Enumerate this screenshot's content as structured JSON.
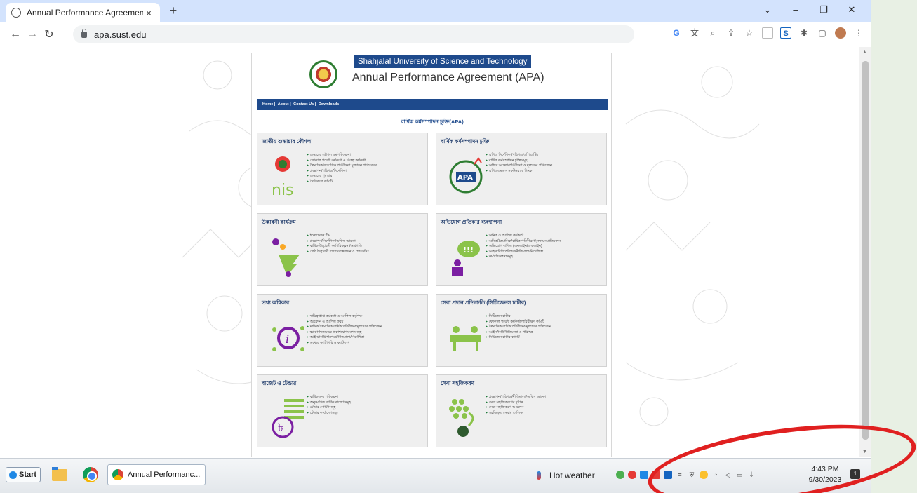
{
  "browser": {
    "tab_title": "Annual Performance Agreement",
    "tab_close": "×",
    "new_tab": "+",
    "window_controls": [
      "⌄",
      "–",
      "❐",
      "✕"
    ],
    "url": "apa.sust.edu",
    "toolbar_icons": [
      "google-icon",
      "translate-icon",
      "zoom-icon",
      "share-icon",
      "bookmark-star-icon",
      "extension-icon",
      "s-extension-icon",
      "puzzle-icon",
      "sidepanel-icon",
      "profile-avatar-icon",
      "menu-icon"
    ]
  },
  "site": {
    "university": "Shahjalal University of Science and Technology",
    "title": "Annual Performance Agreement (APA)",
    "menu": [
      "Home |",
      "About |",
      "Contact Us |",
      "Downloads"
    ],
    "subtitle": "বার্ষিক কর্মসম্পাদন চুক্তি(APA)",
    "cards": [
      {
        "title": "জাতীয় শুদ্ধাচার কৌশল",
        "icon": "nis-icon",
        "items": [
          "শুদ্ধাচার কৌশল কর্মপরিকল্পনা",
          "ফোকাল পয়েন্ট কর্মকর্তা ও বিকল্প কর্মকর্তা",
          "ত্রৈমাসিক/ষাণ্মাসিক পরিবীক্ষণ মূল্যায়ন প্রতিবেদন",
          "প্রজ্ঞাপন/পরিপত্র/নির্দেশিকা",
          "শুদ্ধাচার পুরস্কার",
          "নৈতিকতা কমিটি"
        ]
      },
      {
        "title": "বার্ষিক কর্মসম্পাদন চুক্তি",
        "icon": "apa-icon",
        "items": [
          "এপিএ নির্দেশিকা/পরিপত্র/এপিএ টিম",
          "বার্ষিক কর্মসম্পাদন চুক্তিসমূহ",
          "অফিস আদেশ/পরিবীক্ষণ ও মূল্যায়ন প্রতিবেদন",
          "এপিএএমএস সফটওয়্যার লিংক"
        ]
      },
      {
        "title": "উদ্ভাবনী কার্যক্রম",
        "icon": "innovation-icon",
        "items": [
          "ইনোভেশন টিম",
          "প্রজ্ঞাপন/নির্দেশিকা/অফিস আদেশ",
          "বার্ষিক উদ্ভাবনী কর্মপরিকল্পনা/অগ্রগতি",
          "শ্রেষ্ঠ উদ্ভাবনী ধারণা/বাস্তবায়ন ও শোকেসিং"
        ]
      },
      {
        "title": "অভিযোগ প্রতিকার ব্যবস্থাপনা",
        "icon": "grievance-icon",
        "items": [
          "অনিক ও আপিল কর্মকর্তা",
          "অনিক/ত্রৈমাসিক/বার্ষিক পরিবীক্ষণ/মূল্যায়ন প্রতিবেদন",
          "অভিযোগ দাখিল (অনলাইন/অফলাইন)",
          "আইন/বিধি/পরিপত্র/নীতিমালা/নির্দেশিকা",
          "কর্মপরিকল্পনাসমূহ"
        ]
      },
      {
        "title": "তথ্য অধিকার",
        "icon": "information-icon",
        "items": [
          "দায়িত্বপ্রাপ্ত কর্মকর্তা ও আপিল কর্তৃপক্ষ",
          "আবেদন ও আপিল ফরম",
          "মাসিক/ত্রৈমাসিক/বার্ষিক পরিবীক্ষণ/মূল্যায়ন প্রতিবেদন",
          "স্বপ্রণোদিতভাবে প্রকাশযোগ্য তথ্যসমূহ",
          "আইন/বিধি/পরিপত্র/নীতিমালা/নির্দেশিকা",
          "তথ্যের ক্যাটাগরি ও ক্যাটালগ"
        ]
      },
      {
        "title": "সেবা প্রদান প্রতিশ্রুতি (সিটিজেনস চার্টার)",
        "icon": "citizen-charter-icon",
        "items": [
          "সিটিজেন চার্টার",
          "ফোকাল পয়েন্ট কর্মকর্তা/পরিবীক্ষণ কমিটি",
          "ত্রৈমাসিক/বার্ষিক পরিবীক্ষণ/মূল্যায়ন প্রতিবেদন",
          "আইন/বিধি/নীতিমালা ও পরিপত্র",
          "সিটিজেন চার্টার কমিটি"
        ]
      },
      {
        "title": "বাজেট ও টেন্ডার",
        "icon": "budget-icon",
        "items": [
          "বার্ষিক ক্রয় পরিকল্পনা",
          "অনুমোদিত বার্ষিক বাজেটসমূহ",
          "টেন্ডার নোটিশসমূহ",
          "টেন্ডার কার্যাদেশসমূহ"
        ]
      },
      {
        "title": "সেবা সহজিকরণ",
        "icon": "service-simplification-icon",
        "items": [
          "প্রজ্ঞাপন/পরিপত্র/নীতিমালা/অফিস আদেশ",
          "সেবা সহজিকরণের দৃষ্টান্ত",
          "সেবা সহজিকরণ আবেদন",
          "সহজিকৃত সেবার তালিকা"
        ]
      }
    ]
  },
  "taskbar": {
    "start_label": "Start",
    "app_label": "Annual Performanc...",
    "weather": "Hot weather",
    "time": "4:43 PM",
    "date": "9/30/2023",
    "notification_count": "1"
  }
}
